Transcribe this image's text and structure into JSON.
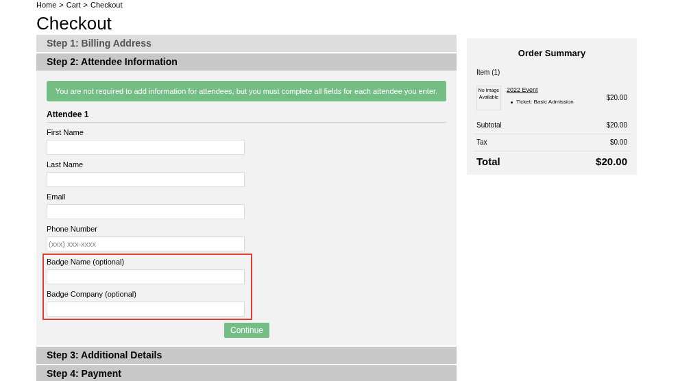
{
  "breadcrumb": [
    "Home",
    ">",
    "Cart",
    ">",
    "Checkout"
  ],
  "title": "Checkout",
  "steps": [
    {
      "label": "Step 1: Billing Address",
      "completed": true,
      "expanded": false
    },
    {
      "label": "Step 2: Attendee Information",
      "completed": false,
      "expanded": true
    },
    {
      "label": "Step 3: Additional Details",
      "completed": false,
      "expanded": false
    },
    {
      "label": "Step 4: Payment",
      "completed": false,
      "expanded": false
    }
  ],
  "attendee_form": {
    "notice": "You are not required to add information for attendees, but you must complete all fields for each attendee you enter.",
    "heading": "Attendee 1",
    "fields": [
      {
        "label": "First Name"
      },
      {
        "label": "Last Name"
      },
      {
        "label": "Email"
      },
      {
        "label": "Phone Number",
        "placeholder": "(xxx) xxx-xxxx"
      }
    ],
    "highlighted_fields": [
      {
        "label": "Badge Name (optional)"
      },
      {
        "label": "Badge Company (optional)"
      }
    ],
    "button": "Continue"
  },
  "order_summary": {
    "title": "Order Summary",
    "item_count": "Item (1)",
    "image_text": "No Image Available",
    "items": [
      {
        "name": "2022 Event",
        "detail": "Ticket: Basic Admission",
        "price": "$20.00"
      }
    ],
    "rows": [
      {
        "label": "Subtotal",
        "value": "$20.00"
      },
      {
        "label": "Tax",
        "value": "$0.00"
      }
    ],
    "total": {
      "label": "Total",
      "value": "$20.00"
    }
  }
}
